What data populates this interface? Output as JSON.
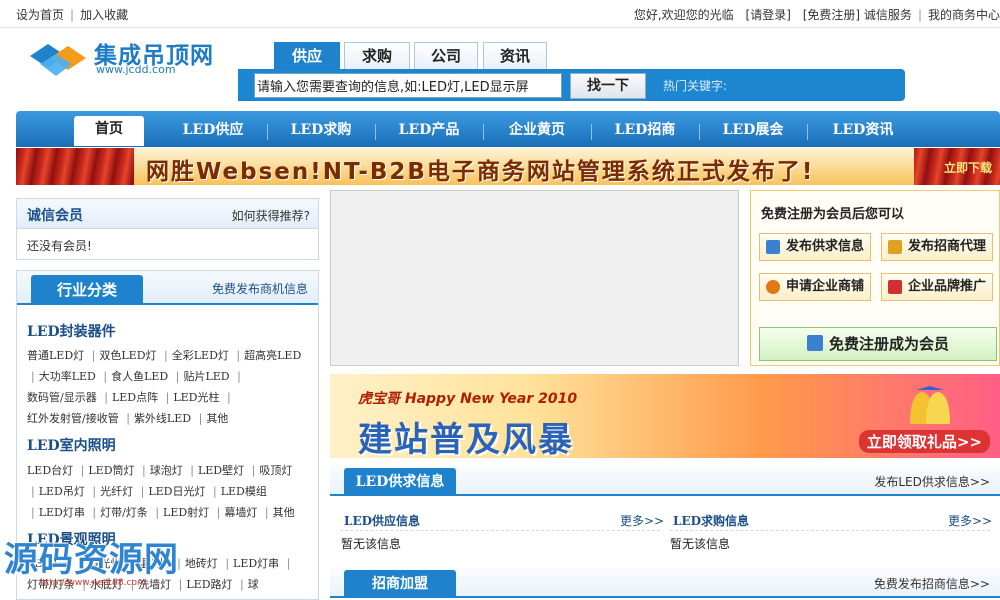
{
  "topbar": {
    "set_home": "设为首页",
    "add_fav": "加入收藏",
    "welcome": "您好,欢迎您的光临",
    "login": "[请登录]",
    "register": "[免费注册]",
    "trust": "诚信服务",
    "my_business": "我的商务中心"
  },
  "logo": {
    "name": "集成吊顶网",
    "url": "www.jcdd.com"
  },
  "search": {
    "tabs": [
      "供应",
      "求购",
      "公司",
      "资讯"
    ],
    "active_tab": "供应",
    "value": "请输入您需要查询的信息,如:LED灯,LED显示屏",
    "button": "找一下",
    "hot_label": "热门关键字:"
  },
  "nav": {
    "items": [
      "首页",
      "LED供应",
      "LED求购",
      "LED产品",
      "企业黄页",
      "LED招商",
      "LED展会",
      "LED资讯"
    ],
    "active": "首页"
  },
  "banner": {
    "text": "网胜Websen!NT-B2B电子商务网站管理系统正式发布了!",
    "download": "立即下载"
  },
  "member": {
    "title": "诚信会员",
    "how": "如何获得推荐?",
    "empty": "还没有会员!"
  },
  "category": {
    "tab": "行业分类",
    "publish": "免费发布商机信息",
    "groups": [
      {
        "name": "LED封装器件",
        "items": [
          "普通LED灯",
          "双色LED灯",
          "全彩LED灯",
          "超高亮LED",
          "大功率LED",
          "食人鱼LED",
          "贴片LED",
          "数码管/显示器",
          "LED点阵",
          "LED光柱",
          "红外发射管/接收管",
          "紫外线LED",
          "其他"
        ]
      },
      {
        "name": "LED室内照明",
        "items": [
          "LED台灯",
          "LED筒灯",
          "球泡灯",
          "LED壁灯",
          "吸顶灯",
          "LED吊灯",
          "光纤灯",
          "LED日光灯",
          "LED模组",
          "LED灯串",
          "灯带/灯条",
          "LED射灯",
          "幕墙灯",
          "其他"
        ]
      },
      {
        "name": "LED景观照明",
        "items": [
          "LED射灯",
          "投光灯",
          "埋地灯",
          "地砖灯",
          "LED灯串",
          "灯带/灯条",
          "水底灯",
          "洗墙灯",
          "LED路灯",
          "球"
        ]
      }
    ]
  },
  "register_box": {
    "title": "免费注册为会员后您可以",
    "buttons": [
      "发布供求信息",
      "发布招商代理",
      "申请企业商铺",
      "企业品牌推广"
    ],
    "big_button": "免费注册成为会员",
    "colors": {
      "btn1": "#3b7fd0",
      "btn2": "#e0a020",
      "btn3": "#e07a10",
      "btn4": "#d03030",
      "big": "#3b7fd0"
    }
  },
  "ad": {
    "year_text": "虎宝哥 Happy New Year 2010",
    "headline": "建站普及风暴",
    "cta": "立即领取礼品>>"
  },
  "supply_section": {
    "tab": "LED供求信息",
    "more": "发布LED供求信息>>",
    "left_title": "LED供应信息",
    "left_more": "更多>>",
    "left_empty": "暂无该信息",
    "right_title": "LED求购信息",
    "right_more": "更多>>",
    "right_empty": "暂无该信息"
  },
  "invest_section": {
    "tab": "招商加盟",
    "more": "免费发布招商信息>>"
  },
  "watermark": {
    "text": "源码资源网",
    "url": "http://www.net188.com"
  },
  "colors": {
    "brand": "#1e82cc",
    "nav": "#1a6fb8",
    "title": "#1b4f8a"
  }
}
